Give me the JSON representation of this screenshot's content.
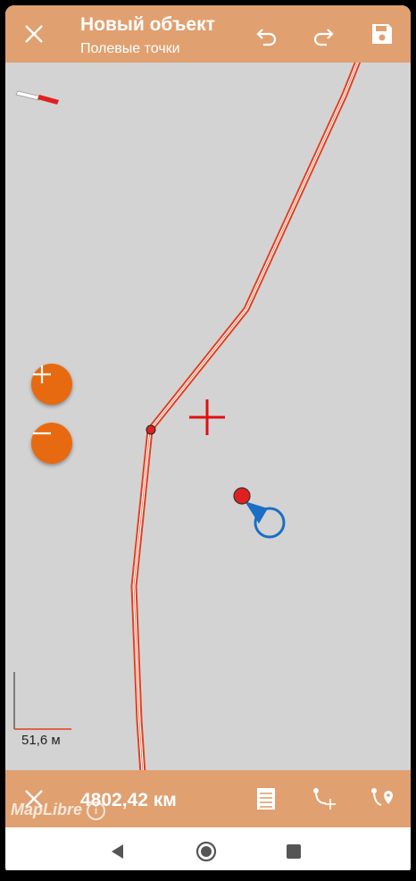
{
  "header": {
    "title": "Новый объект",
    "subtitle": "Полевые точки",
    "icons": [
      "close-icon",
      "undo-icon",
      "redo-icon",
      "save-icon"
    ]
  },
  "map": {
    "zoom_controls": [
      "zoom-in-icon",
      "zoom-out-icon"
    ],
    "scale_label": "51,6 м",
    "attribution": "MapLibre"
  },
  "bottom_bar": {
    "distance": "4802,42 км",
    "icons": [
      "close-icon",
      "list-icon",
      "add-vertex-icon",
      "add-point-icon"
    ]
  },
  "nav": {
    "icons": [
      "back-icon",
      "home-icon",
      "recents-icon"
    ]
  },
  "colors": {
    "bar": "#e0a070",
    "accent": "#e86a10",
    "line": "#e04020",
    "location": "#1a6fc4",
    "map_bg": "#d3d3d3"
  }
}
